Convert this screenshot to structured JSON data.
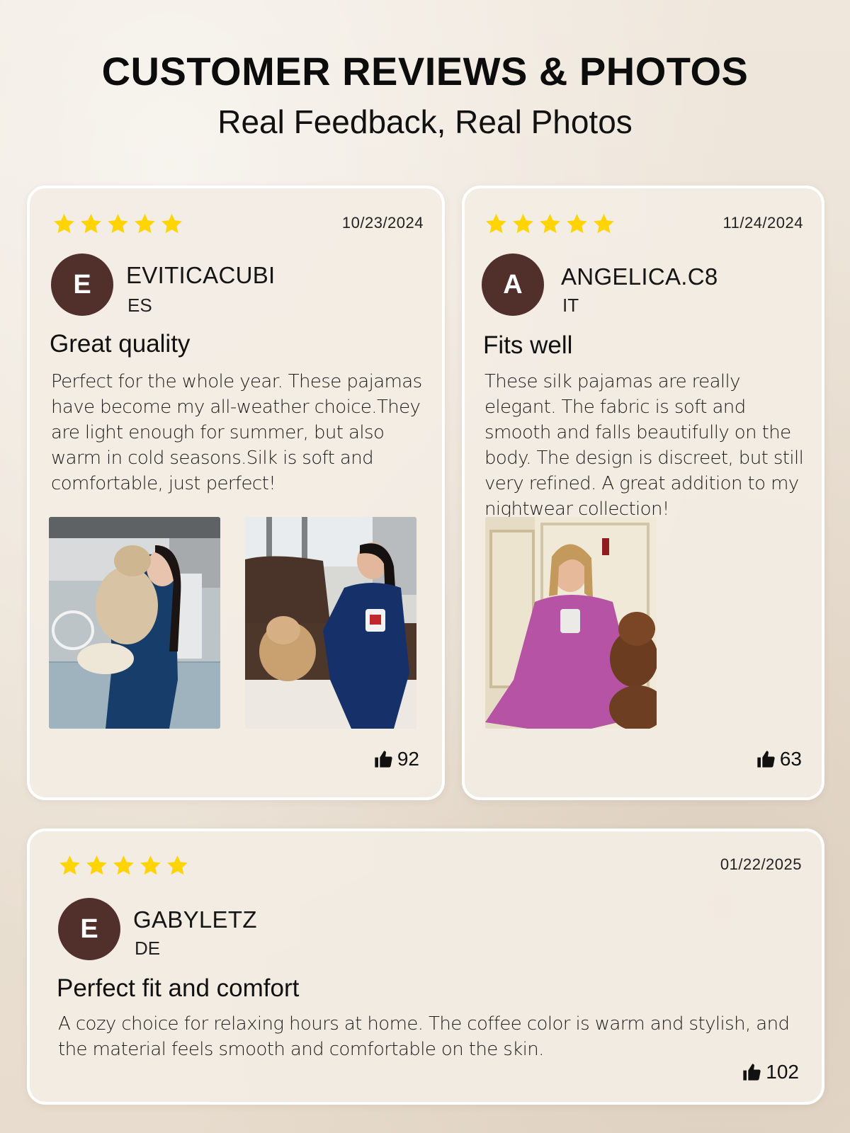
{
  "header": {
    "title": "CUSTOMER REVIEWS & PHOTOS",
    "subtitle": "Real Feedback, Real Photos"
  },
  "colors": {
    "star": "#ffd400",
    "avatar_bg": "#512f2a",
    "card_border": "#ffffff"
  },
  "reviews": [
    {
      "rating": 5,
      "date": "10/23/2024",
      "avatar_letter": "E",
      "name": "EVITICACUBI",
      "country": "ES",
      "title": "Great quality",
      "body": "Perfect for the whole year. These pajamas have become my all-weather choice.They are light enough for summer, but also warm in cold seasons.Silk is soft and comfortable, just perfect!",
      "photos": [
        "woman-hugging-dog-navy-pajamas",
        "woman-with-dog-on-sofa-navy-pajamas"
      ],
      "likes": "92"
    },
    {
      "rating": 5,
      "date": "11/24/2024",
      "avatar_letter": "A",
      "name": "ANGELICA.C8",
      "country": "IT",
      "title": "Fits well",
      "body": "These silk pajamas are really elegant. The fabric is soft and smooth and falls beautifully on the body. The design is discreet, but still very refined. A great addition to my nightwear collection!",
      "photos": [
        "woman-pink-pajamas-with-teddy-bear"
      ],
      "likes": "63"
    },
    {
      "rating": 5,
      "date": "01/22/2025",
      "avatar_letter": "E",
      "name": "GABYLETZ",
      "country": "DE",
      "title": "Perfect fit and comfort",
      "body": "A cozy choice for relaxing hours at home. The coffee color is warm and stylish, and the material feels smooth and comfortable on the skin.",
      "photos": [],
      "likes": "102"
    }
  ],
  "icons": {
    "star": "star-icon",
    "like": "thumbs-up-icon"
  }
}
